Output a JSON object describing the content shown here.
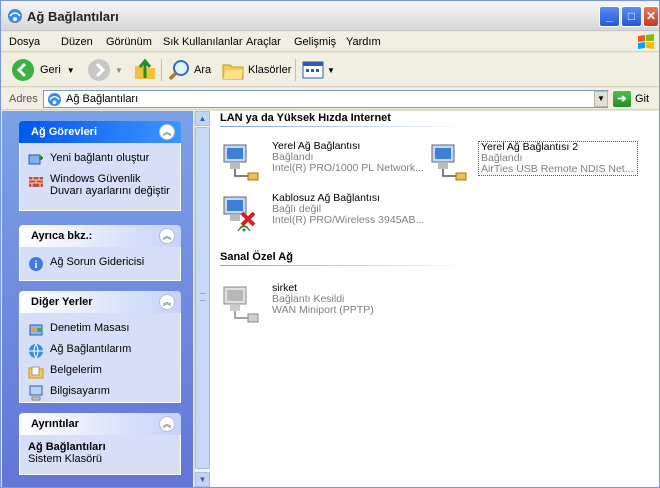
{
  "window": {
    "title": "Ağ Bağlantıları"
  },
  "menu": [
    "Dosya",
    "Düzen",
    "Görünüm",
    "Sık Kullanılanlar",
    "Araçlar",
    "Gelişmiş",
    "Yardım"
  ],
  "toolbar": {
    "back": "Geri",
    "search": "Ara",
    "folders": "Klasörler"
  },
  "address": {
    "label": "Adres",
    "value": "Ağ Bağlantıları",
    "go": "Git"
  },
  "sidebar": {
    "tasks": {
      "title": "Ağ Görevleri",
      "items": [
        "Yeni bağlantı oluştur",
        "Windows Güvenlik Duvarı ayarlarını değiştir"
      ]
    },
    "see_also": {
      "title": "Ayrıca bkz.:",
      "items": [
        "Ağ Sorun Gidericisi"
      ]
    },
    "other_places": {
      "title": "Diğer Yerler",
      "items": [
        "Denetim Masası",
        "Ağ Bağlantılarım",
        "Belgelerim",
        "Bilgisayarım"
      ]
    },
    "details": {
      "title": "Ayrıntılar",
      "name": "Ağ Bağlantıları",
      "type": "Sistem Klasörü"
    }
  },
  "groups": [
    {
      "title": "LAN ya da Yüksek Hızda Internet",
      "items": [
        {
          "name": "Yerel Ağ Bağlantısı",
          "status": "Bağlandı",
          "device": "Intel(R) PRO/1000 PL Network..."
        },
        {
          "name": "Yerel Ağ Bağlantısı 2",
          "status": "Bağlandı",
          "device": "AirTies USB Remote NDIS Net..."
        },
        {
          "name": "Kablosuz Ağ Bağlantısı",
          "status": "Bağlı değil",
          "device": "Intel(R) PRO/Wireless 3945AB..."
        }
      ]
    },
    {
      "title": "Sanal Özel Ağ",
      "items": [
        {
          "name": "sirket",
          "status": "Bağlantı Kesildi",
          "device": "WAN Miniport (PPTP)"
        }
      ]
    }
  ]
}
